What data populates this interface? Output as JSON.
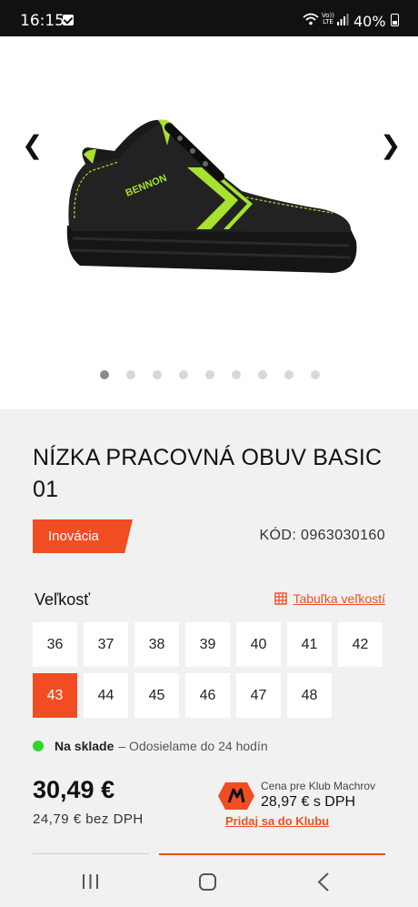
{
  "status_bar": {
    "time": "16:15",
    "volte_label": "Vo)) LTE",
    "battery": "40%"
  },
  "gallery": {
    "prev_arrow": "❮",
    "next_arrow": "❯",
    "image_label": "BENNON",
    "slide_count": 9,
    "active_slide": 1
  },
  "product": {
    "title": "NÍZKA PRACOVNÁ OBUV BASIC 01",
    "badge": "Inovácia",
    "code": "KÓD: 0963030160",
    "size_label": "Veľkosť",
    "size_table_link": "Tabuľka veľkostí",
    "sizes": [
      "36",
      "37",
      "38",
      "39",
      "40",
      "41",
      "42",
      "43",
      "44",
      "45",
      "46",
      "47",
      "48"
    ],
    "selected_size": "43",
    "stock_status": "Na sklade",
    "stock_note": "– Odosielame do 24 hodín",
    "price": "30,49 €",
    "price_net": "24,79 € bez DPH",
    "club_label": "Cena pre Klub Machrov",
    "club_price": "28,97 € s DPH",
    "club_join": "Pridaj sa do Klubu"
  },
  "colors": {
    "accent": "#f04d23",
    "in_stock": "#2ed630",
    "shoe_highlight": "#a6e22e",
    "panel_bg": "#f1f1f1"
  },
  "icons": {
    "notification": "check-square-icon",
    "wifi": "wifi-icon",
    "signal": "signal-icon",
    "battery": "battery-icon",
    "size_table": "grid-table-icon",
    "club": "machrov-logo-icon",
    "nav_recent": "recent-apps-icon",
    "nav_home": "home-icon",
    "nav_back": "back-icon"
  }
}
